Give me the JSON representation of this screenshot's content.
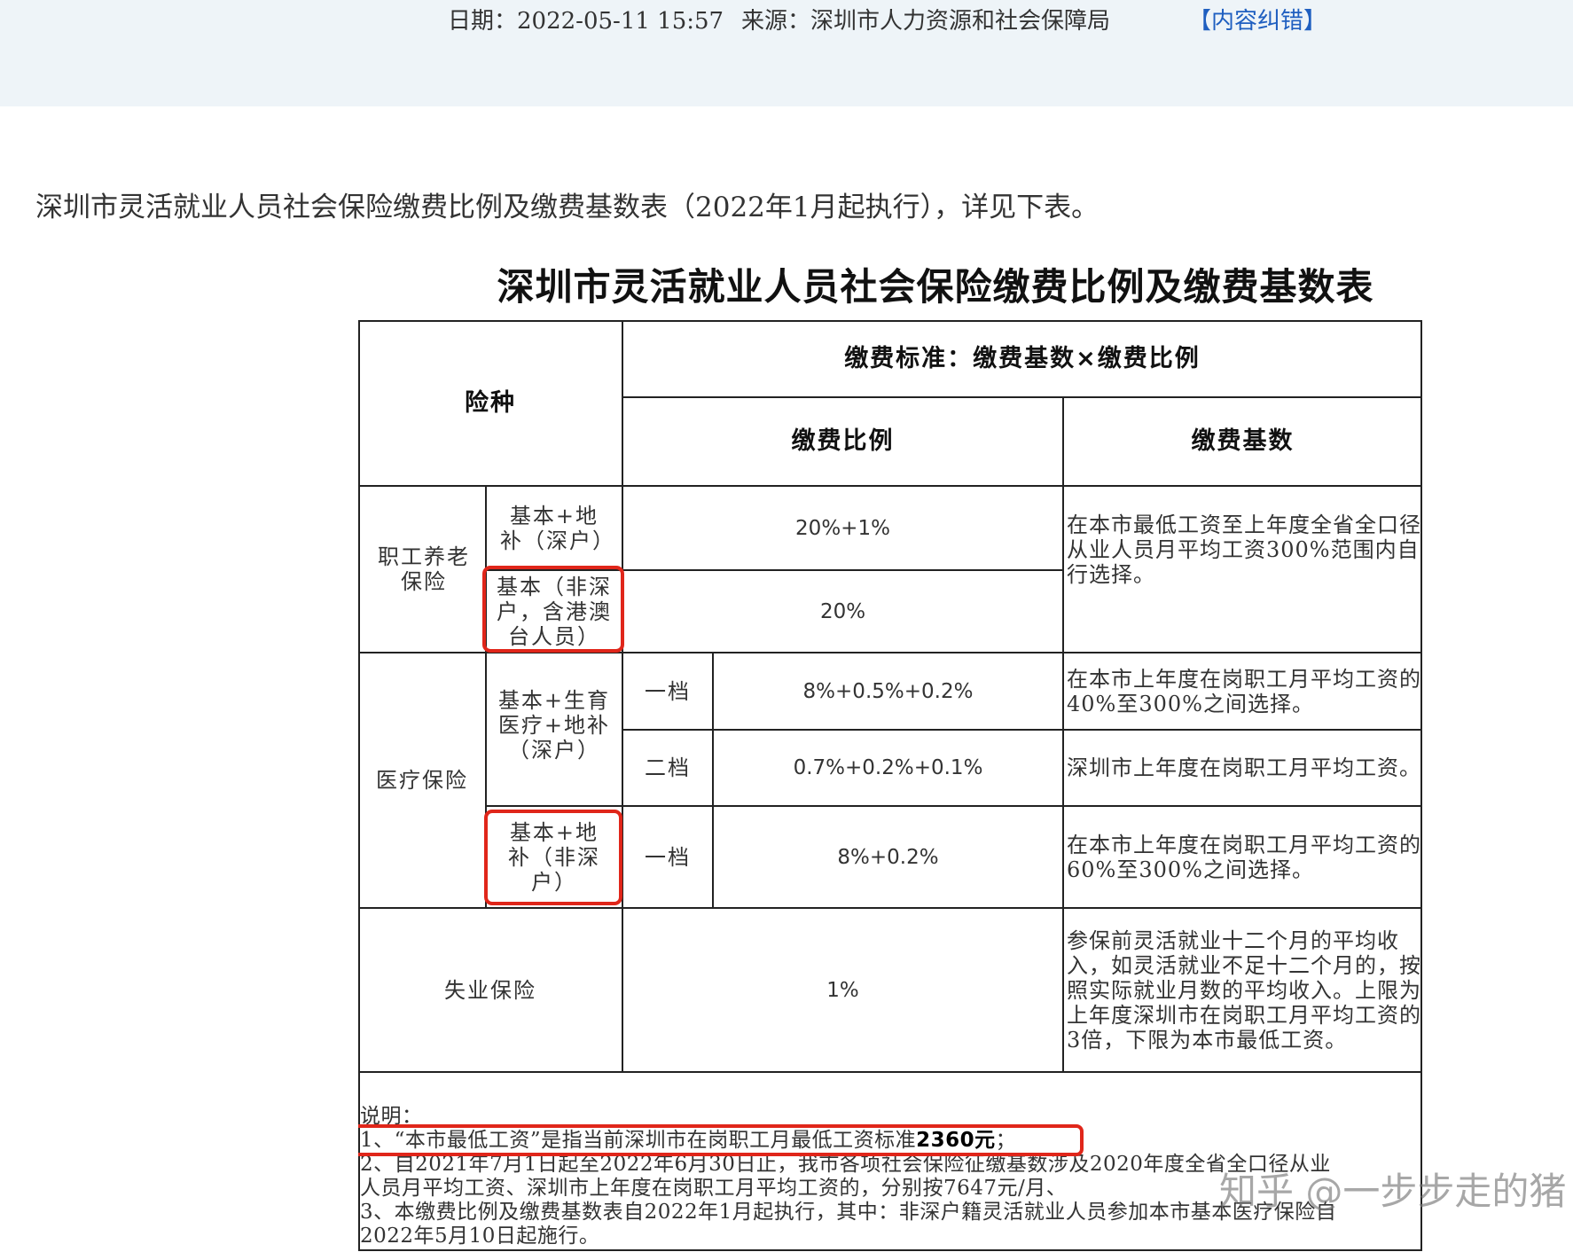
{
  "meta": {
    "date": "日期：2022-05-11 15:57",
    "source": "来源：深圳市人力资源和社会保障局",
    "correct_link": "【内容纠错】"
  },
  "intro": "深圳市灵活就业人员社会保险缴费比例及缴费基数表（2022年1月起执行），详见下表。",
  "table": {
    "title": "深圳市灵活就业人员社会保险缴费比例及缴费基数表",
    "header": {
      "insurance_type": "险种",
      "standard": "缴费标准：缴费基数×缴费比例",
      "rate": "缴费比例",
      "base": "缴费基数"
    },
    "pension": {
      "label": "职工养老保险",
      "row1_type": "基本+地补（深户）",
      "row1_rate": "20%+1%",
      "row2_type": "基本（非深户，含港澳台人员）",
      "row2_rate": "20%",
      "base": "在本市最低工资至上年度全省全口径从业人员月平均工资300%范围内自行选择。"
    },
    "medical": {
      "label": "医疗保险",
      "group1_type": "基本+生育医疗+地补（深户）",
      "tier1_label": "一档",
      "tier1_rate": "8%+0.5%+0.2%",
      "tier1_base": "在本市上年度在岗职工月平均工资的40%至300%之间选择。",
      "tier2_label": "二档",
      "tier2_rate": "0.7%+0.2%+0.1%",
      "tier2_base": "深圳市上年度在岗职工月平均工资。",
      "group2_type": "基本+地补（非深户）",
      "group2_tier_label": "一档",
      "group2_rate": "8%+0.2%",
      "group2_base": "在本市上年度在岗职工月平均工资的60%至300%之间选择。"
    },
    "unemployment": {
      "label": "失业保险",
      "rate": "1%",
      "base": "参保前灵活就业十二个月的平均收入，如灵活就业不足十二个月的，按照实际就业月数的平均收入。上限为上年度深圳市在岗职工月平均工资的3倍，下限为本市最低工资。"
    },
    "notes": {
      "heading": "说明：",
      "note1_prefix": "1、“本市最低工资”是指当前深圳市在岗职工月最低工资标准",
      "note1_amount": "2360元",
      "note1_suffix": "；",
      "note2a": "2、自2021年7月1日起至2022年6月30日止，我市各项社会保险征缴基数涉及2020年度全省全口径从业",
      "note2b": "人员月平均工资、深圳市上年度在岗职工月平均工资的，分别按7647元/月、",
      "note3a": "3、本缴费比例及缴费基数表自2022年1月起执行，其中：非深户籍灵活就业人员参加本市基本医疗保险自",
      "note3b": "2022年5月10日起施行。"
    }
  },
  "watermark": "知乎 @一步步走的猪",
  "colors": {
    "header_band": "#eef4f8",
    "link": "#1f5fc0",
    "highlight": "#e0261a"
  }
}
